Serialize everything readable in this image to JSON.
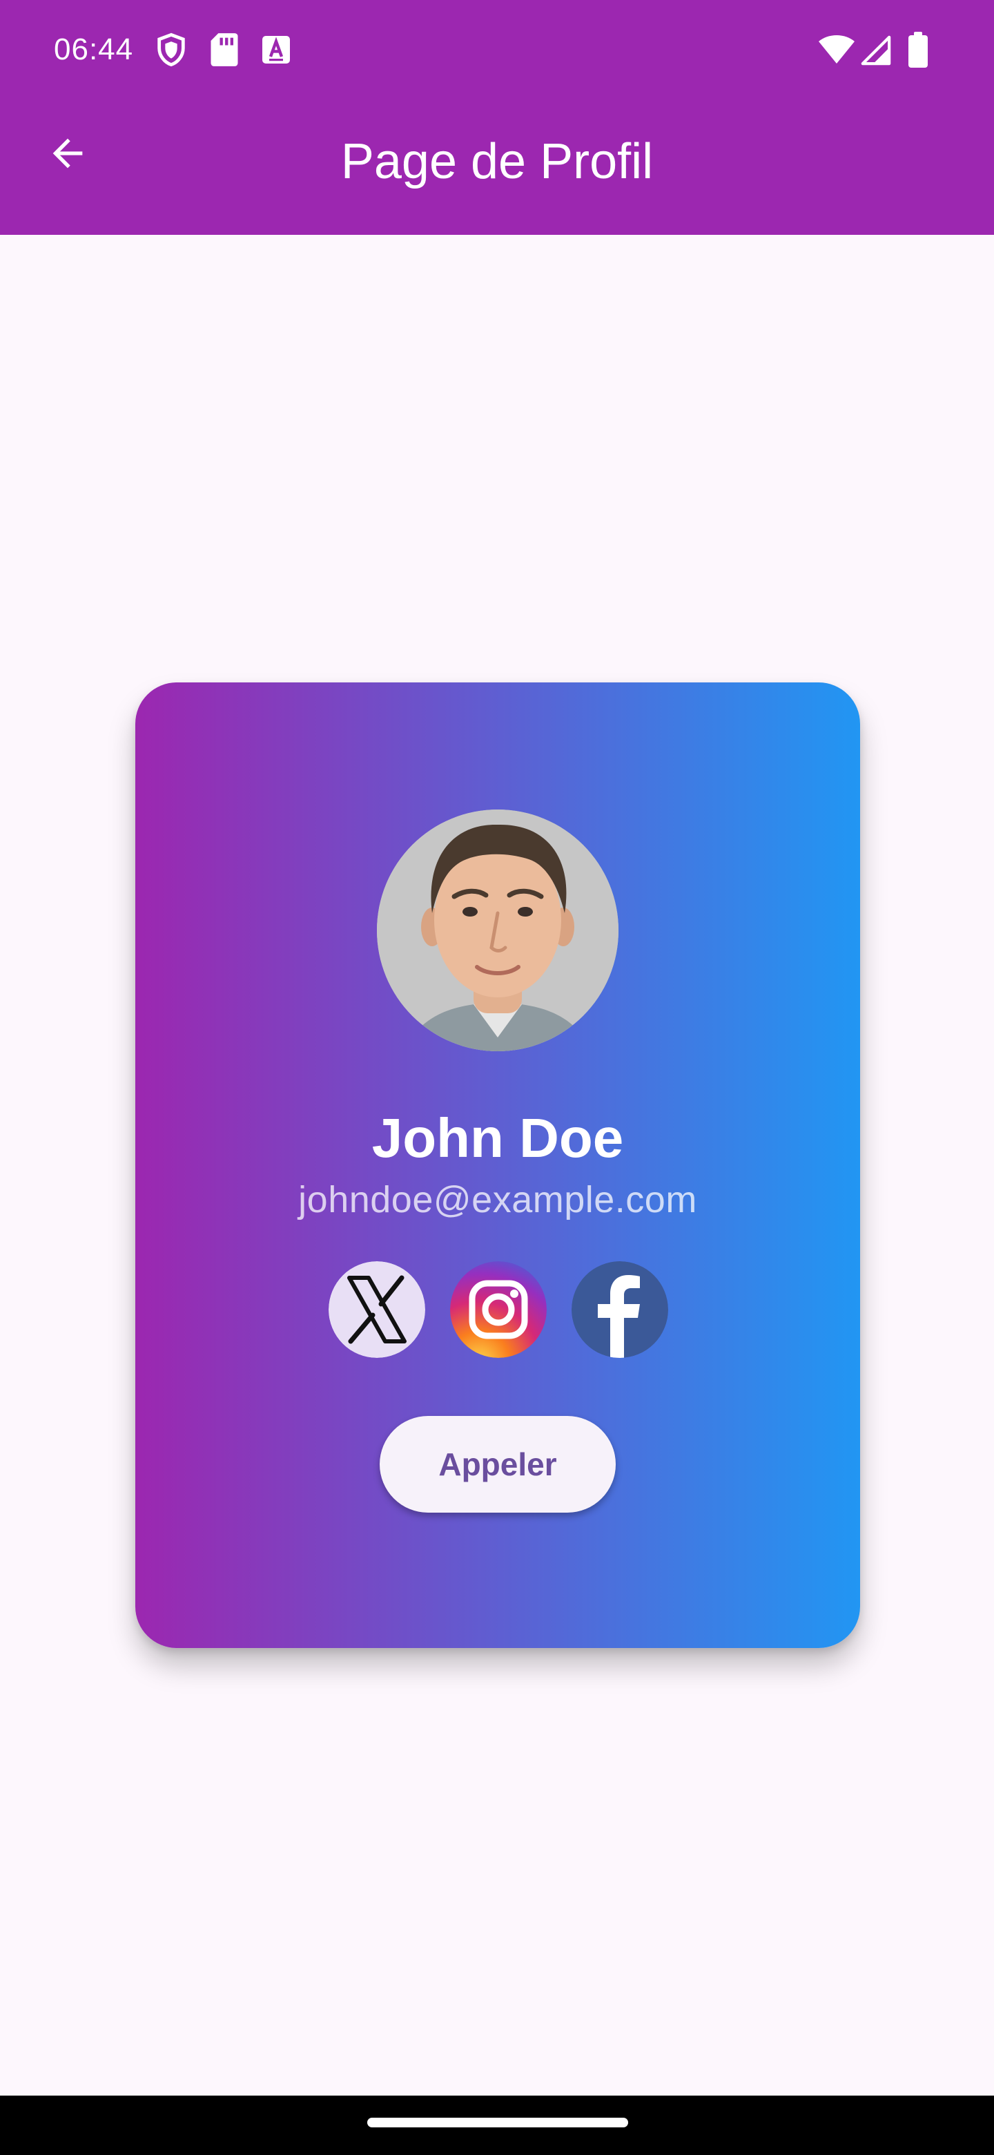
{
  "status_bar": {
    "time": "06:44",
    "left_icons": [
      "shield-icon",
      "sd-card-icon",
      "keyboard-a-icon"
    ],
    "right_icons": [
      "wifi-icon",
      "cell-signal-icon",
      "battery-icon"
    ]
  },
  "app_bar": {
    "title": "Page de Profil",
    "back_icon": "arrow-back-icon"
  },
  "profile": {
    "name": "John Doe",
    "email": "johndoe@example.com",
    "call_button_label": "Appeler",
    "socials": [
      "x-icon",
      "instagram-icon",
      "facebook-icon"
    ]
  },
  "colors": {
    "app_bar": "#9c27b0",
    "gradient_start": "#9c27b0",
    "gradient_end": "#2196f3",
    "background": "#fdf7fd",
    "call_button_bg": "#f7f2fa",
    "call_button_text": "#6a4e9e",
    "x_button_bg": "#e8dff5",
    "facebook_bg": "#3b5998"
  }
}
